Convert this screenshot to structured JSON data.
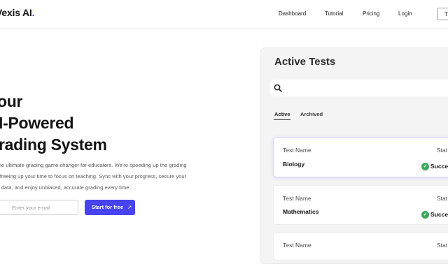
{
  "header": {
    "logo_text": "Vexis AI",
    "logo_dot": ".",
    "nav": [
      "Dashboard",
      "Tutorial",
      "Pricing",
      "Login"
    ],
    "cta_partial": "T"
  },
  "hero": {
    "lines": [
      "our",
      "I-Powered",
      "rading System"
    ],
    "description_lines": [
      "is the ultimate grading game changer for educators. We're speeding up the grading",
      "ss, freeing up your time to focus on teaching. Sync with your progress, secure your",
      "nts' data, and enjoy unbiased, accurate grading every time."
    ],
    "email_placeholder": "Enter your email",
    "cta_label": "Start for free",
    "cta_arrow": "↗"
  },
  "panel": {
    "title": "Active Tests",
    "tabs": [
      "Active",
      "Archived"
    ],
    "active_tab": "Active",
    "cards": [
      {
        "label": "Test Name",
        "name": "Biology",
        "status_label": "Stat",
        "status": "Succe"
      },
      {
        "label": "Test Name",
        "name": "Mathematics",
        "status_label": "Stat",
        "status": "Succe"
      },
      {
        "label": "Test Name",
        "name": "",
        "status_label": "Stat",
        "status": ""
      }
    ]
  },
  "colors": {
    "brand": "#4743f0",
    "success": "#3aa75a"
  }
}
